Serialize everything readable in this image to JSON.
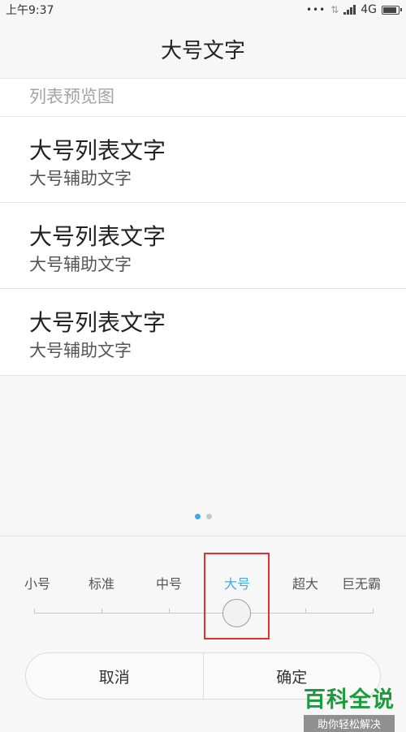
{
  "status_bar": {
    "time": "上午9:37",
    "dots": "•••",
    "network": "4G"
  },
  "header": {
    "title": "大号文字"
  },
  "preview": {
    "section_label": "列表预览图",
    "rows": [
      {
        "primary": "大号列表文字",
        "secondary": "大号辅助文字"
      },
      {
        "primary": "大号列表文字",
        "secondary": "大号辅助文字"
      },
      {
        "primary": "大号列表文字",
        "secondary": "大号辅助文字"
      }
    ]
  },
  "pager": {
    "current_page": 1,
    "total_pages": 2
  },
  "font_size": {
    "options": [
      "小号",
      "标准",
      "中号",
      "大号",
      "超大",
      "巨无霸"
    ],
    "selected": "大号",
    "selected_index": 3
  },
  "buttons": {
    "cancel": "取消",
    "confirm": "确定"
  },
  "watermark": {
    "main": "百科全说",
    "sub": "助你轻松解决"
  },
  "colors": {
    "accent": "#3fa9e9",
    "highlight": "#e0312e",
    "watermark_green": "#1a9b3c"
  }
}
